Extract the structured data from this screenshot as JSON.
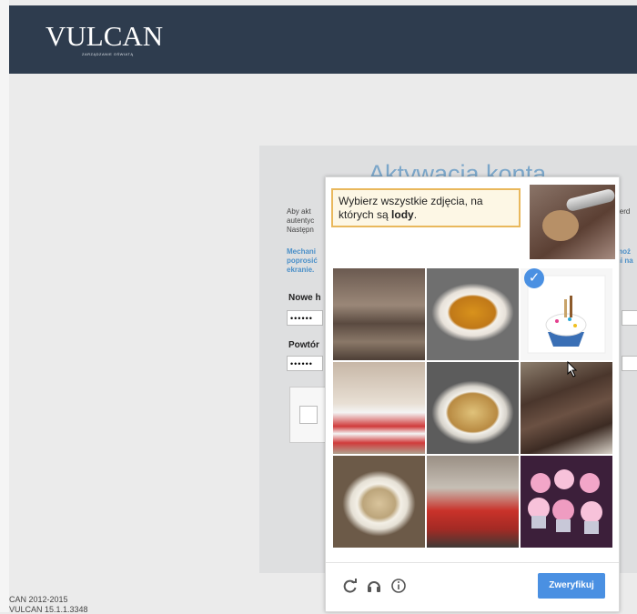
{
  "header": {
    "logo_text": "VULCAN",
    "logo_subtitle": "ZARZĄDZANIE OŚWIATĄ",
    "background_color": "#2e3c4e"
  },
  "activation": {
    "title": "Aktywacja konta",
    "intro_lines": [
      "Aby akt",
      "autentyc",
      "Następn"
    ],
    "right_intro_fragment": "ierd",
    "mechanism_lines": [
      "Mechani",
      "poprosić",
      "ekranie."
    ],
    "right_mechanism_lines": [
      "moż",
      "ni na"
    ],
    "new_password_label": "Nowe h",
    "new_password_value": "••••••",
    "repeat_password_label": "Powtór",
    "repeat_password_value": "••••••"
  },
  "footer": {
    "copyright": "CAN 2012-2015",
    "version": "VULCAN 15.1.1.3348"
  },
  "captcha": {
    "prompt_before": "Wybierz wszystkie zdjęcia, na których są ",
    "prompt_target": "lody",
    "prompt_after": ".",
    "sample_image_icon": "ice-cream-scoop-image",
    "tiles": [
      {
        "icon": "sausages-image",
        "selected": false
      },
      {
        "icon": "soup-bowl-image",
        "selected": false
      },
      {
        "icon": "cupcake-image",
        "selected": true
      },
      {
        "icon": "decorated-cake-image",
        "selected": false
      },
      {
        "icon": "ramen-bowl-image",
        "selected": false
      },
      {
        "icon": "grilled-meat-image",
        "selected": false
      },
      {
        "icon": "pasta-plate-image",
        "selected": false
      },
      {
        "icon": "fast-food-tray-image",
        "selected": false
      },
      {
        "icon": "cupcakes-image",
        "selected": false
      }
    ],
    "reload_icon": "reload-icon",
    "audio_icon": "headphones-icon",
    "info_icon": "info-icon",
    "verify_label": "Zweryfikuj",
    "accent_color": "#4a90e2",
    "prompt_border_color": "#e9b85c"
  }
}
